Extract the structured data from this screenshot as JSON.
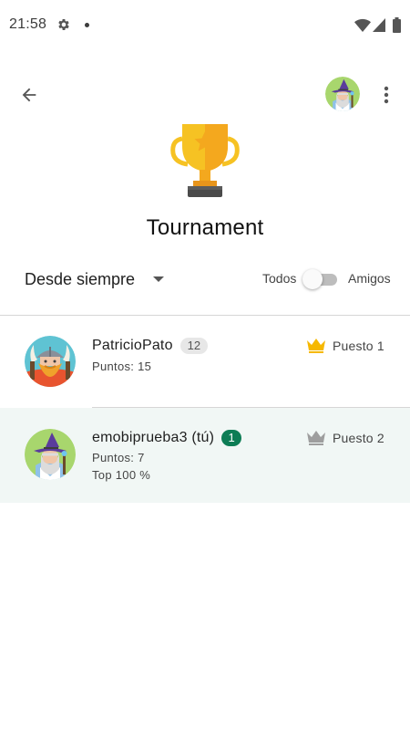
{
  "status_bar": {
    "time": "21:58",
    "icons": [
      "settings-gear-icon",
      "notification-dot-icon",
      "wifi-icon",
      "cell-signal-icon",
      "battery-icon"
    ]
  },
  "header": {
    "back_icon": "arrow-back-icon",
    "avatar_icon": "wizard-avatar-icon",
    "more_icon": "more-vert-icon"
  },
  "title": "Tournament",
  "filters": {
    "range_selected": "Desde siempre",
    "toggle_left_label": "Todos",
    "toggle_right_label": "Amigos",
    "toggle_on": false
  },
  "leaderboard": [
    {
      "name": "PatricioPato",
      "level": "12",
      "points": "Puntos: 15",
      "rank": "Puesto 1",
      "avatar": "viking-avatar-icon",
      "crown_color": "#f6b800"
    },
    {
      "name": "emobiprueba3 (tú)",
      "level": "1",
      "points": "Puntos: 7",
      "top": "Top 100 %",
      "rank": "Puesto 2",
      "avatar": "wizard-avatar-icon",
      "crown_color": "#9e9e9e"
    }
  ],
  "colors": {
    "accent_green": "#0d7d55",
    "highlight_row": "#f1f7f5",
    "gold": "#f6b800"
  }
}
